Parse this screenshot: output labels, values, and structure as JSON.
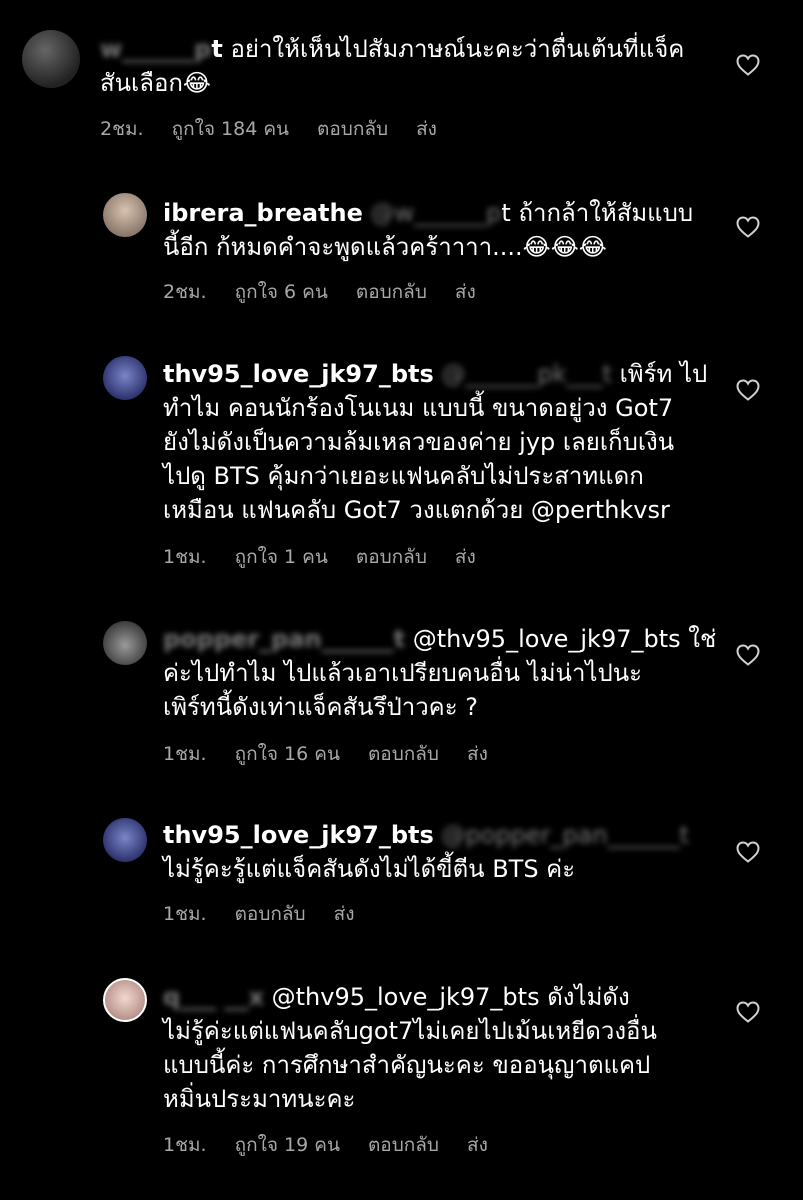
{
  "comments": [
    {
      "user_blur": "w______p",
      "user_visible": "t",
      "text": " อย่าให้เห็นไปสัมภาษณ์นะคะว่าตื่นเต้นที่แจ็คสันเลือก",
      "emoji": "😂",
      "time": "2ชม.",
      "likes": "ถูกใจ 184 คน",
      "reply": "ตอบกลับ",
      "send": "ส่ง"
    },
    {
      "user": "ibrera_breathe",
      "mention_blur": "@w______p",
      "mention_visible": "t",
      "text": " ถ้ากล้าให้สัมแบบนี้อีก ก้หมดคำจะพูดแล้วคร้าาาา....",
      "emoji": "😂😂😂",
      "time": "2ชม.",
      "likes": "ถูกใจ 6 คน",
      "reply": "ตอบกลับ",
      "send": "ส่ง"
    },
    {
      "user": "thv95_love_jk97_bts",
      "mention_blur": "@______pk___t",
      "line1_tail": " เพิร์ท ไป",
      "lines": [
        "ทำไม คอนนักร้องโนเนม แบบนี้ ขนาดอยู่วง Got7",
        "ยังไม่ดังเป็นความล้มเหลวของค่าย jyp เลยเก็บเงิน",
        "ไปดู BTS คุ้มกว่าเยอะแฟนคลับไม่ประสาทแดก",
        "เหมือน แฟนคลับ Got7 วงแตกด้วย  @perthkvsr"
      ],
      "time": "1ชม.",
      "likes": "ถูกใจ 1 คน",
      "reply": "ตอบกลับ",
      "send": "ส่ง"
    },
    {
      "user_blur": "popper_pan______t",
      "mention": " @thv95_love_jk97_bts ใช่",
      "lines": [
        "ค่ะไปทำไม ไปแล้วเอาเปรียบคนอื่น ไม่น่าไปนะ",
        "เพิร์ทนี้ดังเท่าแจ็คสันรึป่าวคะ ?"
      ],
      "time": "1ชม.",
      "likes": "ถูกใจ 16 คน",
      "reply": "ตอบกลับ",
      "send": "ส่ง"
    },
    {
      "user": "thv95_love_jk97_bts",
      "mention_blur": "@popper_pan______t",
      "lines": [
        "ไม่รู้คะรู้แต่แจ็คสันดังไม่ได้ขี้ตีน BTS ค่ะ"
      ],
      "time": "1ชม.",
      "reply": "ตอบกลับ",
      "send": "ส่ง"
    },
    {
      "user_blur": "q___ __x",
      "mention": " @thv95_love_jk97_bts  ดังไม่ดัง",
      "lines": [
        "ไม่รู้ค่ะแต่แฟนคลับgot7ไม่เคยไปเม้นเหยีดวงอื่น",
        "แบบนี้ค่ะ การศึกษาสำคัญนะคะ ขออนุญาตแคป",
        "หมิ่นประมาทนะคะ"
      ],
      "time": "1ชม.",
      "likes": "ถูกใจ 19 คน",
      "reply": "ตอบกลับ",
      "send": "ส่ง"
    }
  ]
}
